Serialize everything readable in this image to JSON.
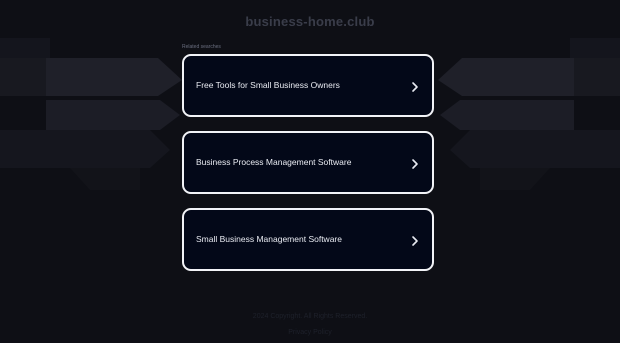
{
  "page": {
    "domain": "business-home.club",
    "section_label": "Related searches"
  },
  "links": [
    {
      "label": "Free Tools for Small Business Owners",
      "icon": "chevron-right-icon"
    },
    {
      "label": "Business Process Management Software",
      "icon": "chevron-right-icon"
    },
    {
      "label": "Small Business Management Software",
      "icon": "chevron-right-icon"
    }
  ],
  "footer": {
    "line1": "2024 Copyright. All Rights Reserved.",
    "line2": "Privacy Policy"
  },
  "colors": {
    "background": "#0e0f15",
    "card_background": "#030818",
    "card_border": "#f2f3f7",
    "text": "#e9ebf2"
  }
}
